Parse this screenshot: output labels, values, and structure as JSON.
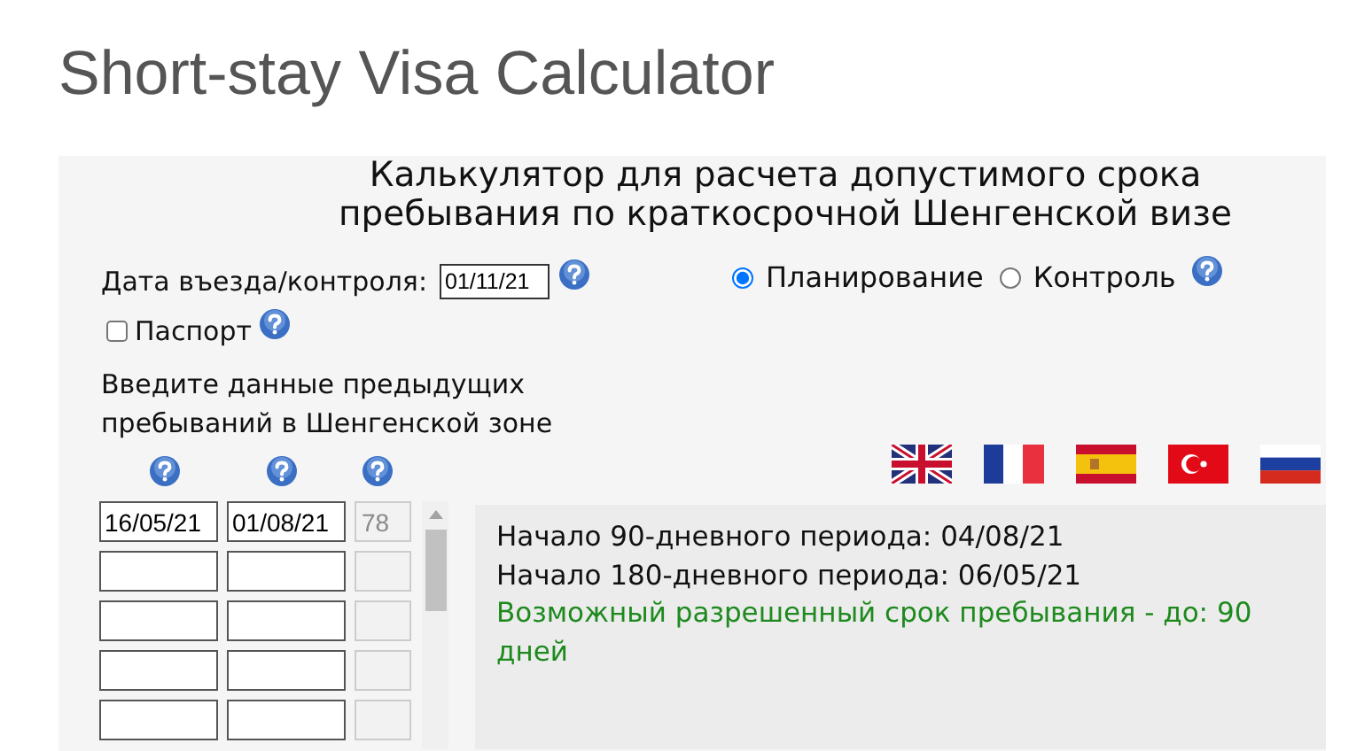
{
  "title": "Short-stay Visa Calculator",
  "heading": [
    "Калькулятор для расчета допустимого срока",
    "пребывания по краткосрочной Шенгенской визе"
  ],
  "entry_date": {
    "label": "Дата въезда/контроля:",
    "value": "01/11/21"
  },
  "passport": {
    "label": "Паспорт",
    "checked": false
  },
  "modes": [
    {
      "label": "Планирование",
      "selected": true
    },
    {
      "label": "Контроль",
      "selected": false
    }
  ],
  "instructions": "Введите данные предыдущих пребываний в Шенгенской зоне",
  "flags": [
    {
      "kind": "uk"
    },
    {
      "kind": "fr"
    },
    {
      "kind": "es"
    },
    {
      "kind": "tr"
    },
    {
      "kind": "ru"
    }
  ],
  "stays": [
    {
      "kind": "filled",
      "entry": "16/05/21",
      "exit": "01/08/21",
      "days": "78"
    },
    {
      "kind": "blank"
    },
    {
      "kind": "blank"
    },
    {
      "kind": "blank"
    },
    {
      "kind": "blank"
    }
  ],
  "results": [
    {
      "kind": "info",
      "text": "Начало 90-дневного периода: 04/08/21"
    },
    {
      "kind": "info",
      "text": "Начало 180-дневного периода: 06/05/21"
    },
    {
      "kind": "allowed",
      "text": "Возможный разрешенный срок пребывания - до: 90 дней"
    }
  ]
}
